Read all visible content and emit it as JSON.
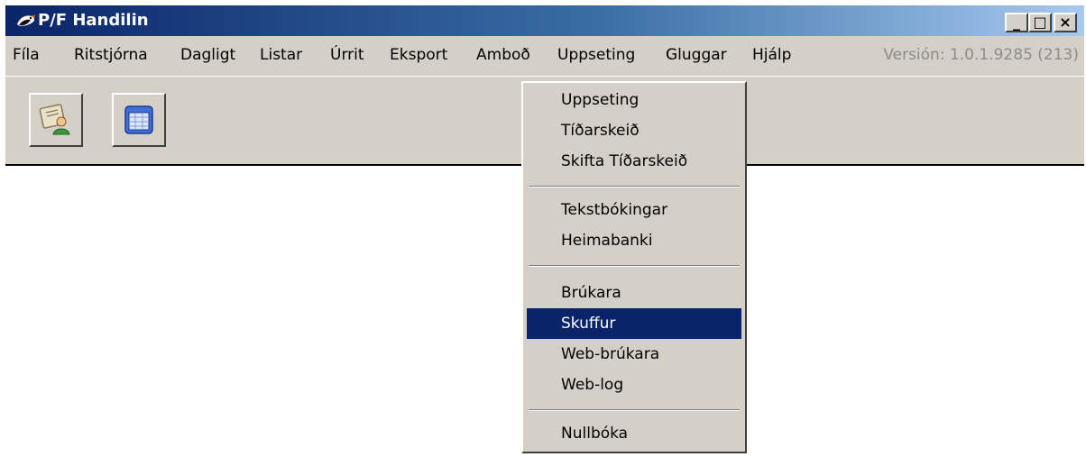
{
  "window": {
    "title": "P/F Handilin",
    "controls": {
      "minimize": "_",
      "maximize": "□",
      "close": "×"
    }
  },
  "menubar": {
    "items": [
      "Fíla",
      "Ritstjórna",
      "Dagligt",
      "Listar",
      "Úrrit",
      "Eksport",
      "Amboð",
      "Uppseting",
      "Gluggar",
      "Hjálp"
    ],
    "open_menu": "Uppseting",
    "version": "Versión: 1.0.1.9285 (213)"
  },
  "toolbar": {
    "buttons": [
      {
        "icon": "user-document-icon"
      },
      {
        "icon": "calendar-window-icon"
      }
    ]
  },
  "dropdown": {
    "items": [
      "Uppseting",
      "Tíðarskeið",
      "Skifta Tíðarskeið",
      "Tekstbókingar",
      "Heimabanki",
      "Brúkara",
      "Skuffur",
      "Web-brúkara",
      "Web-log",
      "Nullbóka"
    ],
    "highlighted": "Skuffur"
  },
  "colors": {
    "title_gradient_start": "#0a246a",
    "title_gradient_end": "#a6caf0",
    "highlight": "#0a246a",
    "face": "#d4d0c8"
  }
}
